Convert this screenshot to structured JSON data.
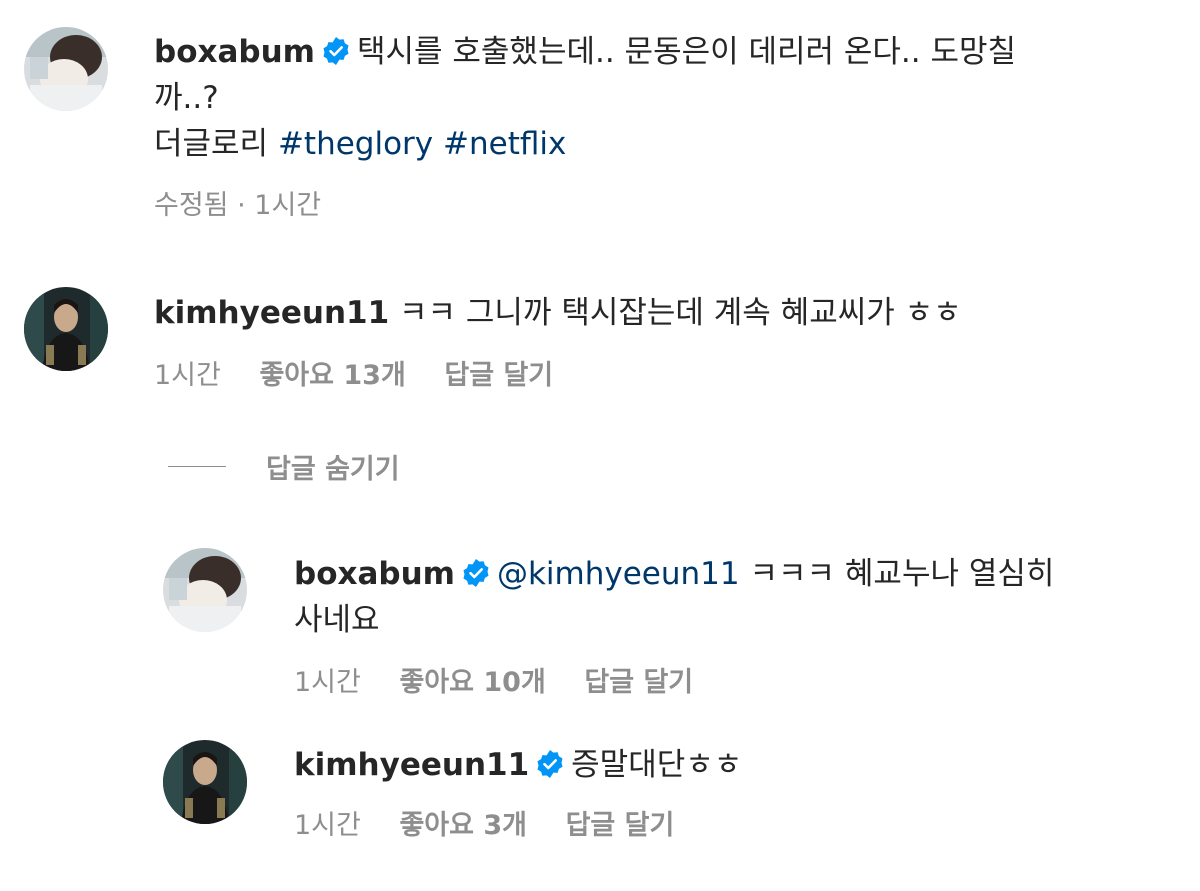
{
  "colors": {
    "text": "#262626",
    "secondary": "#8e8e8e",
    "link": "#00376b",
    "verified": "#0095f6"
  },
  "icons": {
    "verified": "verified-badge-icon"
  },
  "caption": {
    "username": "boxabum",
    "text_line1": "택시를 호출했는데.. 문동은이 데리러 온다.. 도망칠",
    "text_line2": "까..?",
    "text_line3": "더글로리",
    "hashtag1": "#theglory",
    "hashtag2": "#netflix",
    "meta": "수정됨 · 1시간"
  },
  "comment1": {
    "username": "kimhyeeun11",
    "text": "ㅋㅋ 그니까 택시잡는데 계속 혜교씨가 ㅎㅎ",
    "time": "1시간",
    "likes": "좋아요 13개",
    "reply": "답글 달기"
  },
  "hide_replies_label": "답글 숨기기",
  "reply1": {
    "username": "boxabum",
    "mention": "@kimhyeeun11",
    "text_line1": "ㅋㅋㅋ 혜교누나 열심히",
    "text_line2": "사네요",
    "time": "1시간",
    "likes": "좋아요 10개",
    "reply": "답글 달기"
  },
  "reply2": {
    "username": "kimhyeeun11",
    "text": "증말대단ㅎㅎ",
    "time": "1시간",
    "likes": "좋아요 3개",
    "reply": "답글 달기"
  }
}
